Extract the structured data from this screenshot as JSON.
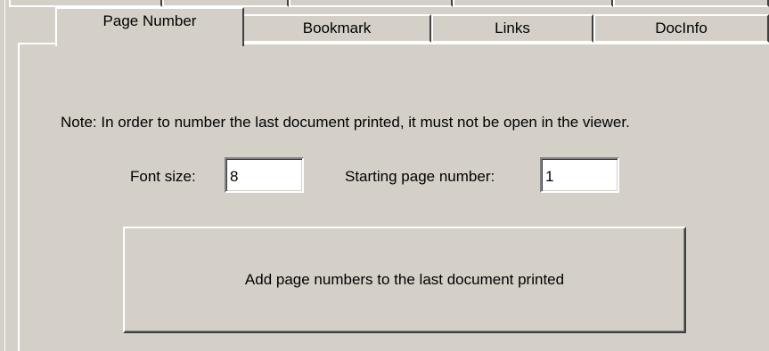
{
  "tabs": [
    {
      "label": "Page Number",
      "active": true
    },
    {
      "label": "Bookmark",
      "active": false
    },
    {
      "label": "Links",
      "active": false
    },
    {
      "label": "DocInfo",
      "active": false
    }
  ],
  "note": "Note: In order to number the last document printed, it must not be open in the viewer.",
  "font_size": {
    "label": "Font size:",
    "value": "8"
  },
  "start_page": {
    "label": "Starting page number:",
    "value": "1"
  },
  "add_button": {
    "label": "Add page numbers to the last document printed"
  },
  "colors": {
    "face": "#d4d0c8",
    "highlight": "#ffffff",
    "shadow": "#404040",
    "field_bg": "#ffffff"
  }
}
